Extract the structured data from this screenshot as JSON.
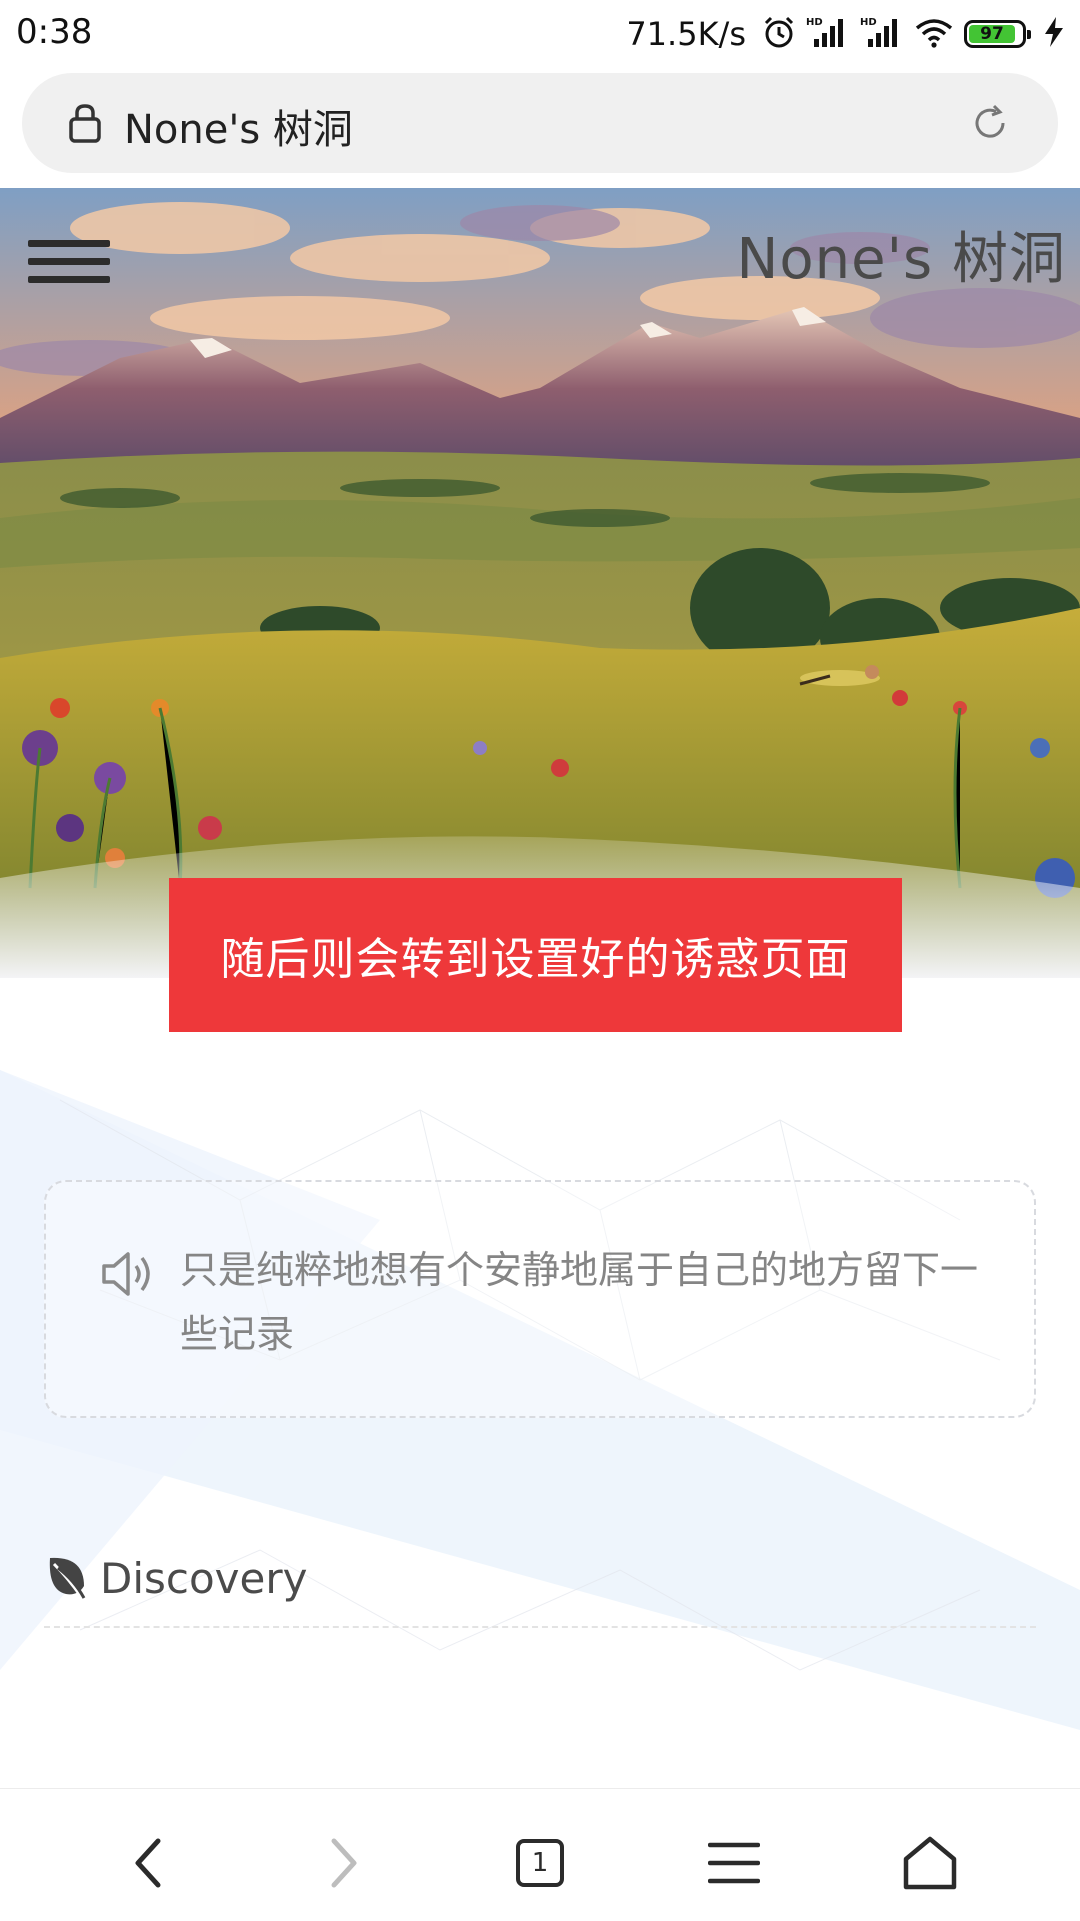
{
  "status_bar": {
    "time": "0:38",
    "net_speed": "71.5K/s",
    "battery_level": "97",
    "icons": [
      "alarm-icon",
      "hd-signal-icon",
      "hd-signal-icon",
      "wifi-icon",
      "battery-icon",
      "charging-icon"
    ]
  },
  "browser": {
    "url_text": "None's 树洞",
    "icons": [
      "lock-icon",
      "reload-icon"
    ]
  },
  "site": {
    "title": "None's 树洞",
    "menu_icon": "hamburger-icon"
  },
  "notice": {
    "text": "随后则会转到设置好的诱惑页面",
    "color": "#ee383a"
  },
  "announcement": {
    "icon": "speaker-icon",
    "text": "只是纯粹地想有个安静地属于自己的地方留下一些记录"
  },
  "discovery": {
    "icon": "leaf-icon",
    "label": "Discovery"
  },
  "bottom_nav": {
    "tab_count": "1",
    "items": [
      "back-icon",
      "forward-icon",
      "tabs-icon",
      "menu-icon",
      "home-icon"
    ]
  }
}
